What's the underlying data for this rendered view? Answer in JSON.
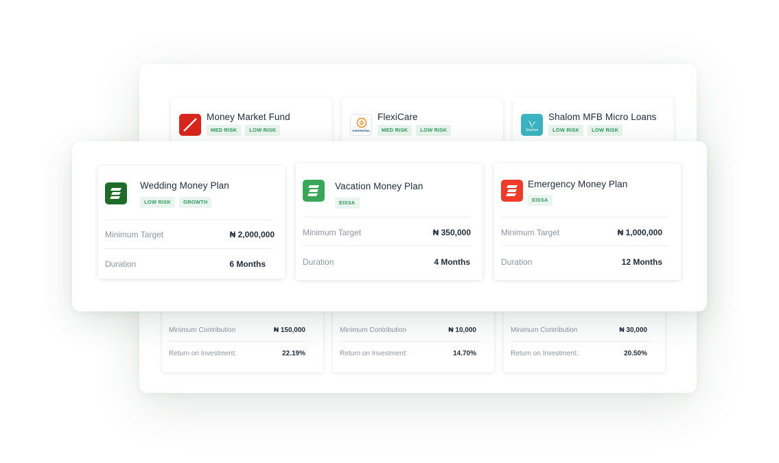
{
  "back_cards": [
    {
      "title": "Money Market Fund",
      "tags": [
        "MED RISK",
        "LOW RISK"
      ],
      "min_contribution_label": "Minimum Contribution",
      "min_contribution_value": "₦ 150,000",
      "roi_label": "Return on Investment:",
      "roi_value": "22.19%"
    },
    {
      "title": "FlexiCare",
      "tags": [
        "MED RISK",
        "LOW RISK"
      ],
      "logo_text": "AutoGenius",
      "min_contribution_label": "Minimum Contribution",
      "min_contribution_value": "₦ 10,000",
      "roi_label": "Return on Investment:",
      "roi_value": "14.70%"
    },
    {
      "title": "Shalom MFB Micro Loans",
      "tags": [
        "LOW RISK",
        "LOW RISK"
      ],
      "logo_text": "Shalom",
      "min_contribution_label": "Minimum Contribution",
      "min_contribution_value": "₦ 30,000",
      "roi_label": "Return on Investment:",
      "roi_value": "20.50%"
    }
  ],
  "front_cards": [
    {
      "title": "Wedding Money Plan",
      "tags": [
        "LOW RISK",
        "GROWTH"
      ],
      "logo_color": "#1e6b2a",
      "min_target_label": "Minimum Target",
      "min_target_value": "₦ 2,000,000",
      "duration_label": "Duration",
      "duration_value": "6 Months"
    },
    {
      "title": "Vacation Money Plan",
      "tags": [
        "EISSA"
      ],
      "logo_color": "#3aa65a",
      "min_target_label": "Minimum Target",
      "min_target_value": "₦ 350,000",
      "duration_label": "Duration",
      "duration_value": "4 Months"
    },
    {
      "title": "Emergency Money Plan",
      "tags": [
        "EISSA"
      ],
      "logo_color": "#ee3b2b",
      "min_target_label": "Minimum Target",
      "min_target_value": "₦ 1,000,000",
      "duration_label": "Duration",
      "duration_value": "12 Months"
    }
  ],
  "colors": {
    "tag_bg": "#e9f5ee",
    "tag_text": "#2e9a5f",
    "label": "#8a95a3",
    "value": "#1f2b3a",
    "mmf_logo_red": "#d9261c",
    "shalom_logo_teal": "#3bb3c0"
  }
}
